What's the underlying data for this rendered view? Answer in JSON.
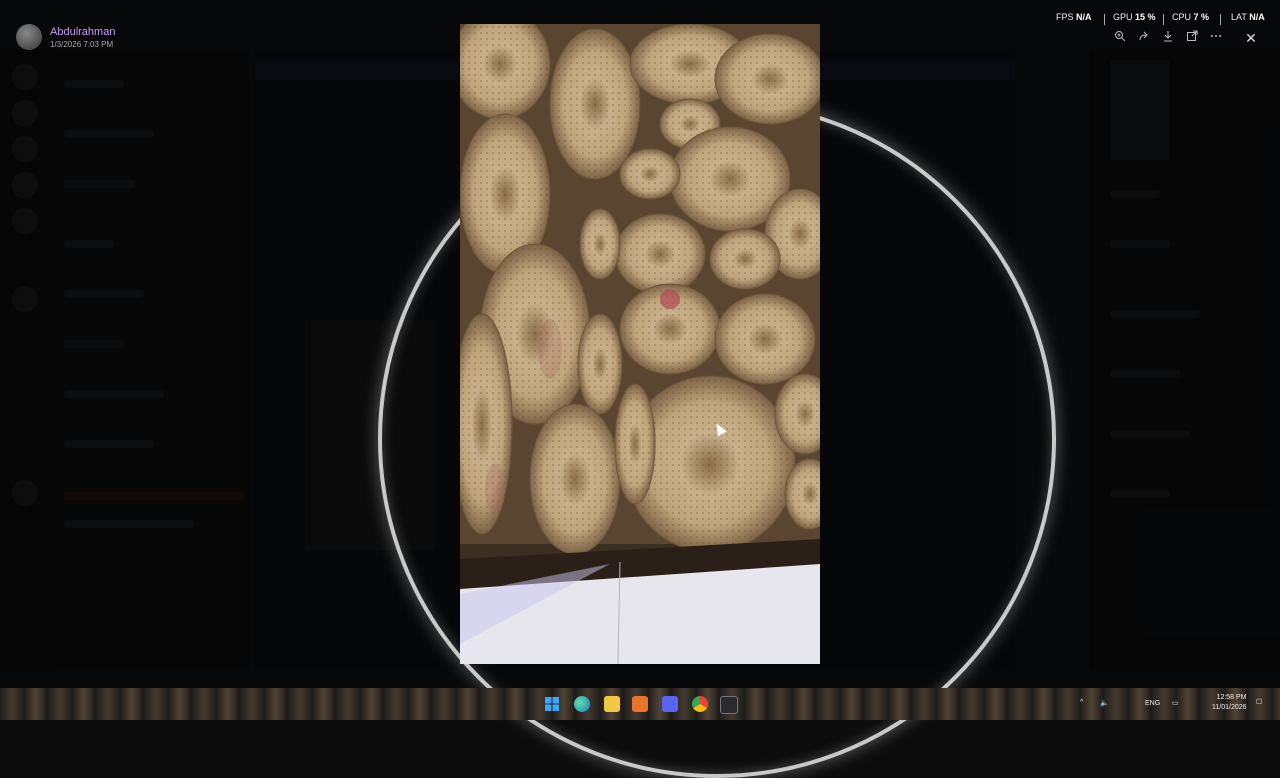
{
  "viewer": {
    "user_name": "Abdulrahman",
    "post_date": "1/3/2026 7:03 PM",
    "close_icon": "✕",
    "tool_icons": [
      "zoom-in-icon",
      "forward-icon",
      "download-icon",
      "open-external-icon",
      "more-icon"
    ]
  },
  "perf": {
    "fps_label": "FPS",
    "fps_value": "N/A",
    "gpu_label": "GPU",
    "gpu_value": "15 %",
    "cpu_label": "CPU",
    "cpu_value": "7 %",
    "lat_label": "LAT",
    "lat_value": "N/A"
  },
  "taskbar": {
    "language": "ENG",
    "time": "12:58 PM",
    "date": "11/01/2026"
  },
  "colors": {
    "accent_name": "#c69cf0",
    "ring": "#ebebeb"
  }
}
